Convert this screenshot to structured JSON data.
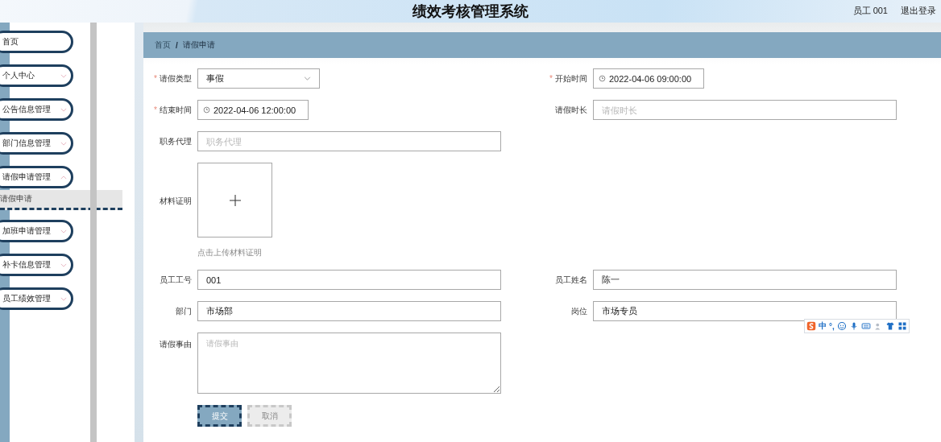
{
  "header": {
    "title": "绩效考核管理系统",
    "user": "员工 001",
    "logout": "退出登录"
  },
  "sidebar": {
    "items": [
      {
        "label": "首页",
        "kind": "link"
      },
      {
        "label": "个人中心",
        "kind": "submenu",
        "expanded": false
      },
      {
        "label": "公告信息管理",
        "kind": "submenu",
        "expanded": false
      },
      {
        "label": "部门信息管理",
        "kind": "submenu",
        "expanded": false
      },
      {
        "label": "请假申请管理",
        "kind": "submenu",
        "expanded": true,
        "children": [
          {
            "label": "请假申请",
            "selected": true
          }
        ]
      },
      {
        "label": "加班申请管理",
        "kind": "submenu",
        "expanded": false
      },
      {
        "label": "补卡信息管理",
        "kind": "submenu",
        "expanded": false
      },
      {
        "label": "员工绩效管理",
        "kind": "submenu",
        "expanded": false
      }
    ]
  },
  "breadcrumb": {
    "items": [
      "首页",
      "请假申请"
    ],
    "separator": "/"
  },
  "form": {
    "required_mark": "*",
    "rows": [
      [
        {
          "label": "请假类型",
          "required": true,
          "kind": "select",
          "value": "事假"
        },
        {
          "label": "开始时间",
          "required": true,
          "kind": "datetime",
          "value": "2022-04-06 09:00:00"
        }
      ],
      [
        {
          "label": "结束时间",
          "required": true,
          "kind": "datetime",
          "value": "2022-04-06 12:00:00"
        },
        {
          "label": "请假时长",
          "required": false,
          "kind": "text",
          "placeholder": "请假时长"
        }
      ],
      [
        {
          "label": "职务代理",
          "required": false,
          "kind": "text",
          "placeholder": "职务代理"
        }
      ],
      [
        {
          "label": "材料证明",
          "required": false,
          "kind": "upload",
          "hint": "点击上传材料证明"
        }
      ],
      [
        {
          "label": "员工工号",
          "required": false,
          "kind": "text",
          "value": "001"
        },
        {
          "label": "员工姓名",
          "required": false,
          "kind": "text",
          "value": "陈一"
        }
      ],
      [
        {
          "label": "部门",
          "required": false,
          "kind": "text",
          "value": "市场部"
        },
        {
          "label": "岗位",
          "required": false,
          "kind": "text",
          "value": "市场专员"
        }
      ],
      [
        {
          "label": "请假事由",
          "required": false,
          "kind": "textarea",
          "placeholder": "请假事由"
        }
      ]
    ],
    "buttons": [
      {
        "label": "提交",
        "kind": "primary"
      },
      {
        "label": "取消",
        "kind": "secondary"
      }
    ]
  },
  "ime": {
    "mode": "中",
    "punct": "°,"
  }
}
